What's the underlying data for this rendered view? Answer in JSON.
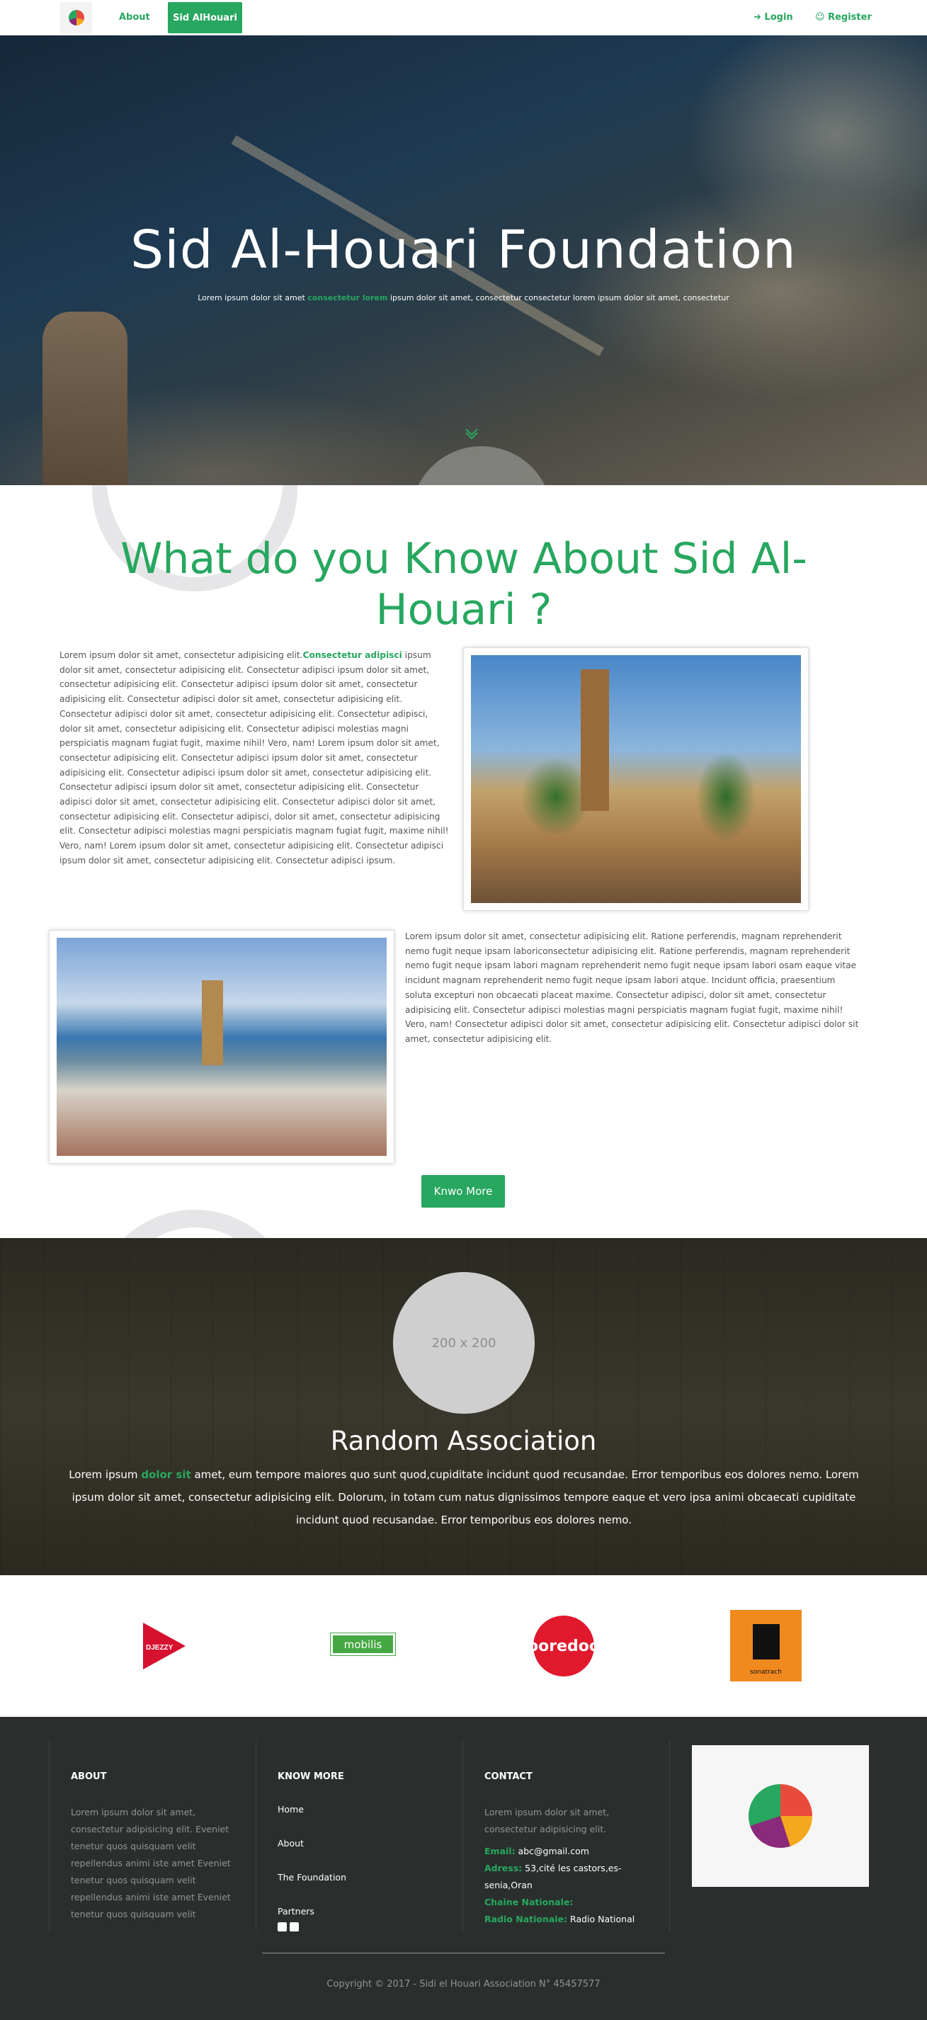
{
  "nav": {
    "logo_alt": "logo",
    "about": "About",
    "active": "Sid AlHouari",
    "login": "Login",
    "register": "Register",
    "accent": "#27a75f"
  },
  "hero": {
    "title": "Sid Al-Houari Foundation",
    "sub_a": "Lorem ipsum dolor sit amet ",
    "sub_hl": "consectetur lorem",
    "sub_b": " ipsum dolor sit amet, consectetur consectetur lorem ipsum dolor sit amet, consectetur",
    "chevron_icon": "chevron-down-icon"
  },
  "about": {
    "heading": "What do you Know About Sid Al-Houari ?",
    "p1_a": "Lorem ipsum dolor sit amet, consectetur adipisicing elit.",
    "p1_hl": "Consectetur adipisci",
    "p1_b": " ipsum dolor sit amet, consectetur adipisicing elit. Consectetur adipisci ipsum dolor sit amet, consectetur adipisicing elit. Consectetur adipisci ipsum dolor sit amet, consectetur adipisicing elit. Consectetur adipisci dolor sit amet, consectetur adipisicing elit. Consectetur adipisci dolor sit amet, consectetur adipisicing elit. Consectetur adipisci, dolor sit amet, consectetur adipisicing elit. Consectetur adipisci molestias magni perspiciatis magnam fugiat fugit, maxime nihil! Vero, nam! Lorem ipsum dolor sit amet, consectetur adipisicing elit. Consectetur adipisci ipsum dolor sit amet, consectetur adipisicing elit. Consectetur adipisci ipsum dolor sit amet, consectetur adipisicing elit. Consectetur adipisci ipsum dolor sit amet, consectetur adipisicing elit. Consectetur adipisci dolor sit amet, consectetur adipisicing elit. Consectetur adipisci dolor sit amet, consectetur adipisicing elit. Consectetur adipisci, dolor sit amet, consectetur adipisicing elit. Consectetur adipisci molestias magni perspiciatis magnam fugiat fugit, maxime nihil! Vero, nam! Lorem ipsum dolor sit amet, consectetur adipisicing elit. Consectetur adipisci ipsum dolor sit amet, consectetur adipisicing elit. Consectetur adipisci ipsum.",
    "p2": "Lorem ipsum dolor sit amet, consectetur adipisicing elit. Ratione perferendis, magnam reprehenderit nemo fugit neque ipsam laboriconsectetur adipisicing elit. Ratione perferendis, magnam reprehenderit nemo fugit neque ipsam labori magnam reprehenderit nemo fugit neque ipsam labori osam eaque vitae incidunt magnam reprehenderit nemo fugit neque ipsam labori atque. Incidunt officia, praesentium soluta excepturi non obcaecati placeat maxime. Consectetur adipisci, dolor sit amet, consectetur adipisicing elit. Consectetur adipisci molestias magni perspiciatis magnam fugiat fugit, maxime nihil! Vero, nam! Consectetur adipisci dolor sit amet, consectetur adipisicing elit. Consectetur adipisci dolor sit amet, consectetur adipisicing elit.",
    "button": "Knwo More"
  },
  "association": {
    "avatar_placeholder": "200 x 200",
    "title": "Random Association",
    "text_a": "Lorem ipsum ",
    "text_hl": "dolor sit",
    "text_b": " amet, eum tempore maiores quo sunt quod,cupiditate incidunt quod recusandae. Error temporibus eos dolores nemo. Lorem ipsum dolor sit amet, consectetur adipisicing elit. Dolorum, in totam cum natus dignissimos tempore eaque et vero ipsa animi obcaecati cupiditate incidunt quod recusandae. Error temporibus eos dolores nemo."
  },
  "sponsors": {
    "djezzy": "DJEZZY",
    "mobilis": "mobilis",
    "ooredoo": "ooredoo",
    "sonatrach": "sonatrach"
  },
  "footer": {
    "about_title": "ABOUT",
    "about_text": "Lorem ipsum dolor sit amet, consectetur adipisicing elit. Eveniet tenetur quos quisquam velit repellendus animi iste amet Eveniet tenetur quos quisquam velit repellendus animi iste amet Eveniet tenetur quos quisquam velit",
    "know_title": "KNOW MORE",
    "links": [
      "Home",
      "About",
      "The Foundation",
      "Partners"
    ],
    "contact_title": "CONTACT",
    "contact_text": "Lorem ipsum dolor sit amet, consectetur adipisicing elit.",
    "email_label": "Email:",
    "email": " abc@gmail.com",
    "address_label": "Adress:",
    "address": " 53,cité les castors,es-senia,Oran",
    "tv_label": "Chaine Nationale:",
    "radio_label": "Radio Nationale:",
    "radio": " Radio National",
    "copyright": "Copyright © 2017 - Sidi el Houari Association N° 45457577"
  }
}
